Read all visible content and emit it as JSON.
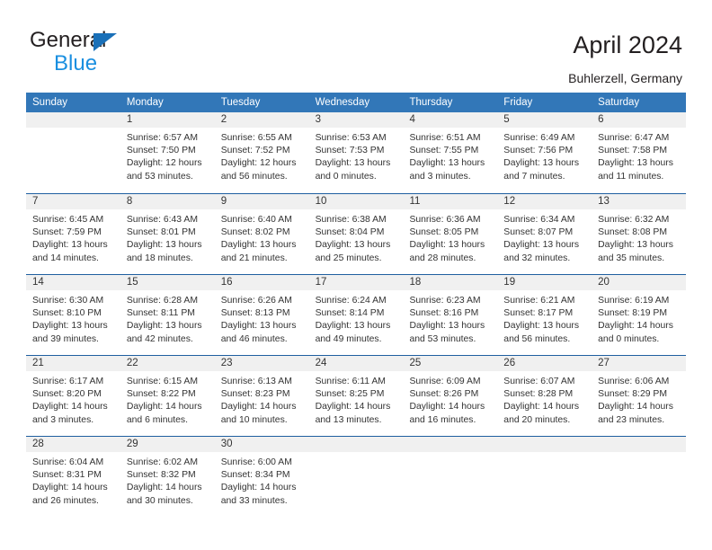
{
  "brand": {
    "line1": "General",
    "line2": "Blue",
    "triangle_icon": "triangle-icon",
    "accent_color": "#1a70b8",
    "accent_color_light": "#1a8fe0"
  },
  "header": {
    "title": "April 2024",
    "subtitle": "Buhlerzell, Germany"
  },
  "colors": {
    "header_blue": "#3277b8",
    "row_divider_blue": "#1f5fa0",
    "daynum_band": "#f0f0f0",
    "text": "#333333"
  },
  "calendar": {
    "weekdays": [
      "Sunday",
      "Monday",
      "Tuesday",
      "Wednesday",
      "Thursday",
      "Friday",
      "Saturday"
    ],
    "weeks": [
      [
        {
          "day": "",
          "lines": []
        },
        {
          "day": "1",
          "lines": [
            "Sunrise: 6:57 AM",
            "Sunset: 7:50 PM",
            "Daylight: 12 hours",
            "and 53 minutes."
          ]
        },
        {
          "day": "2",
          "lines": [
            "Sunrise: 6:55 AM",
            "Sunset: 7:52 PM",
            "Daylight: 12 hours",
            "and 56 minutes."
          ]
        },
        {
          "day": "3",
          "lines": [
            "Sunrise: 6:53 AM",
            "Sunset: 7:53 PM",
            "Daylight: 13 hours",
            "and 0 minutes."
          ]
        },
        {
          "day": "4",
          "lines": [
            "Sunrise: 6:51 AM",
            "Sunset: 7:55 PM",
            "Daylight: 13 hours",
            "and 3 minutes."
          ]
        },
        {
          "day": "5",
          "lines": [
            "Sunrise: 6:49 AM",
            "Sunset: 7:56 PM",
            "Daylight: 13 hours",
            "and 7 minutes."
          ]
        },
        {
          "day": "6",
          "lines": [
            "Sunrise: 6:47 AM",
            "Sunset: 7:58 PM",
            "Daylight: 13 hours",
            "and 11 minutes."
          ]
        }
      ],
      [
        {
          "day": "7",
          "lines": [
            "Sunrise: 6:45 AM",
            "Sunset: 7:59 PM",
            "Daylight: 13 hours",
            "and 14 minutes."
          ]
        },
        {
          "day": "8",
          "lines": [
            "Sunrise: 6:43 AM",
            "Sunset: 8:01 PM",
            "Daylight: 13 hours",
            "and 18 minutes."
          ]
        },
        {
          "day": "9",
          "lines": [
            "Sunrise: 6:40 AM",
            "Sunset: 8:02 PM",
            "Daylight: 13 hours",
            "and 21 minutes."
          ]
        },
        {
          "day": "10",
          "lines": [
            "Sunrise: 6:38 AM",
            "Sunset: 8:04 PM",
            "Daylight: 13 hours",
            "and 25 minutes."
          ]
        },
        {
          "day": "11",
          "lines": [
            "Sunrise: 6:36 AM",
            "Sunset: 8:05 PM",
            "Daylight: 13 hours",
            "and 28 minutes."
          ]
        },
        {
          "day": "12",
          "lines": [
            "Sunrise: 6:34 AM",
            "Sunset: 8:07 PM",
            "Daylight: 13 hours",
            "and 32 minutes."
          ]
        },
        {
          "day": "13",
          "lines": [
            "Sunrise: 6:32 AM",
            "Sunset: 8:08 PM",
            "Daylight: 13 hours",
            "and 35 minutes."
          ]
        }
      ],
      [
        {
          "day": "14",
          "lines": [
            "Sunrise: 6:30 AM",
            "Sunset: 8:10 PM",
            "Daylight: 13 hours",
            "and 39 minutes."
          ]
        },
        {
          "day": "15",
          "lines": [
            "Sunrise: 6:28 AM",
            "Sunset: 8:11 PM",
            "Daylight: 13 hours",
            "and 42 minutes."
          ]
        },
        {
          "day": "16",
          "lines": [
            "Sunrise: 6:26 AM",
            "Sunset: 8:13 PM",
            "Daylight: 13 hours",
            "and 46 minutes."
          ]
        },
        {
          "day": "17",
          "lines": [
            "Sunrise: 6:24 AM",
            "Sunset: 8:14 PM",
            "Daylight: 13 hours",
            "and 49 minutes."
          ]
        },
        {
          "day": "18",
          "lines": [
            "Sunrise: 6:23 AM",
            "Sunset: 8:16 PM",
            "Daylight: 13 hours",
            "and 53 minutes."
          ]
        },
        {
          "day": "19",
          "lines": [
            "Sunrise: 6:21 AM",
            "Sunset: 8:17 PM",
            "Daylight: 13 hours",
            "and 56 minutes."
          ]
        },
        {
          "day": "20",
          "lines": [
            "Sunrise: 6:19 AM",
            "Sunset: 8:19 PM",
            "Daylight: 14 hours",
            "and 0 minutes."
          ]
        }
      ],
      [
        {
          "day": "21",
          "lines": [
            "Sunrise: 6:17 AM",
            "Sunset: 8:20 PM",
            "Daylight: 14 hours",
            "and 3 minutes."
          ]
        },
        {
          "day": "22",
          "lines": [
            "Sunrise: 6:15 AM",
            "Sunset: 8:22 PM",
            "Daylight: 14 hours",
            "and 6 minutes."
          ]
        },
        {
          "day": "23",
          "lines": [
            "Sunrise: 6:13 AM",
            "Sunset: 8:23 PM",
            "Daylight: 14 hours",
            "and 10 minutes."
          ]
        },
        {
          "day": "24",
          "lines": [
            "Sunrise: 6:11 AM",
            "Sunset: 8:25 PM",
            "Daylight: 14 hours",
            "and 13 minutes."
          ]
        },
        {
          "day": "25",
          "lines": [
            "Sunrise: 6:09 AM",
            "Sunset: 8:26 PM",
            "Daylight: 14 hours",
            "and 16 minutes."
          ]
        },
        {
          "day": "26",
          "lines": [
            "Sunrise: 6:07 AM",
            "Sunset: 8:28 PM",
            "Daylight: 14 hours",
            "and 20 minutes."
          ]
        },
        {
          "day": "27",
          "lines": [
            "Sunrise: 6:06 AM",
            "Sunset: 8:29 PM",
            "Daylight: 14 hours",
            "and 23 minutes."
          ]
        }
      ],
      [
        {
          "day": "28",
          "lines": [
            "Sunrise: 6:04 AM",
            "Sunset: 8:31 PM",
            "Daylight: 14 hours",
            "and 26 minutes."
          ]
        },
        {
          "day": "29",
          "lines": [
            "Sunrise: 6:02 AM",
            "Sunset: 8:32 PM",
            "Daylight: 14 hours",
            "and 30 minutes."
          ]
        },
        {
          "day": "30",
          "lines": [
            "Sunrise: 6:00 AM",
            "Sunset: 8:34 PM",
            "Daylight: 14 hours",
            "and 33 minutes."
          ]
        },
        {
          "day": "",
          "lines": []
        },
        {
          "day": "",
          "lines": []
        },
        {
          "day": "",
          "lines": []
        },
        {
          "day": "",
          "lines": []
        }
      ]
    ]
  }
}
